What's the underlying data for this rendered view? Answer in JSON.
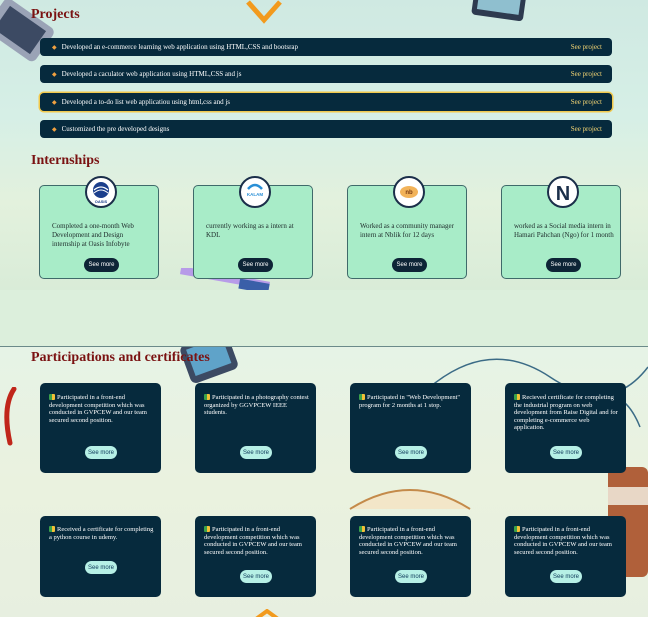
{
  "projects": {
    "title": "Projects",
    "items": [
      {
        "text": "Developed an e-commerce learning web application using HTML,CSS and bootsrap",
        "link": "See project"
      },
      {
        "text": "Developed a caculator web application using HTML,CSS and js",
        "link": "See project"
      },
      {
        "text": "Developed a to-do list web applicatiou using html,css and js",
        "link": "See project"
      },
      {
        "text": "Customized the pre developed designs",
        "link": "See project"
      }
    ]
  },
  "internships": {
    "title": "Internships",
    "items": [
      {
        "logo": "OASIS",
        "text": "Completed a one-month Web Development and Design internship at Oasis Infobyte",
        "button": "See more"
      },
      {
        "logo": "KALAM",
        "text": "currently working as a intern at KDL",
        "button": "See more"
      },
      {
        "logo": "nb",
        "text": "Worked as a community manager intern at Nblik for 12 days",
        "button": "See more"
      },
      {
        "logo": "N",
        "text": "worked as a Social media intern in Hamari Pahchan (Ngo) for 1 month",
        "button": "See more"
      }
    ]
  },
  "certificates": {
    "title": "Participations and certificates",
    "items": [
      {
        "text": "Participated in a front-end development competition which was conducted in GVPCEW and our team secured second position.",
        "button": "See more"
      },
      {
        "text": "Participated in a photography contest organized by GGVPCEW IEEE students.",
        "button": "See more"
      },
      {
        "text": "Participated in \"Web Development\" program for 2 months at 1 stop.",
        "button": "See more"
      },
      {
        "text": "Recieved certificate for completing the industrial program on web development from Raise Digital and for completing e-commerce web application.",
        "button": "See more"
      },
      {
        "text": "Received a certificate for completing a python course in udemy.",
        "button": "See more"
      },
      {
        "text": "Participated in a front-end development competition which was conducted in GVPCEW and our team secured second position.",
        "button": "See more"
      },
      {
        "text": "Participated in a front-end development competition which was conducted in GVPCEW and our team secured second position.",
        "button": "See more"
      },
      {
        "text": "Participated in a front-end development competition which was conducted in GVPCEW and our team secured second position.",
        "button": "See more"
      }
    ]
  }
}
